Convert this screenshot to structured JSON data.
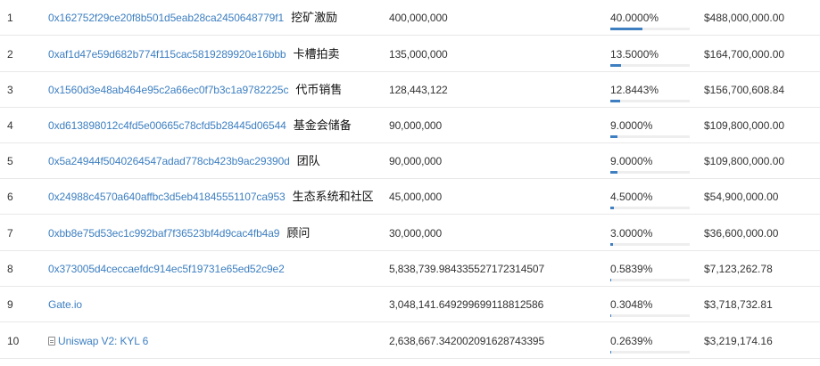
{
  "holders": [
    {
      "rank": "1",
      "address": "0x162752f29ce20f8b501d5eab28ca2450648779f1",
      "tag": "挖矿激励",
      "quantity": "400,000,000",
      "percentage": "40.0000%",
      "fraction": 0.4,
      "value": "$488,000,000.00",
      "icon": ""
    },
    {
      "rank": "2",
      "address": "0xaf1d47e59d682b774f115cac5819289920e16bbb",
      "tag": "卡槽拍卖",
      "quantity": "135,000,000",
      "percentage": "13.5000%",
      "fraction": 0.135,
      "value": "$164,700,000.00",
      "icon": ""
    },
    {
      "rank": "3",
      "address": "0x1560d3e48ab464e95c2a66ec0f7b3c1a9782225c",
      "tag": "代币销售",
      "quantity": "128,443,122",
      "percentage": "12.8443%",
      "fraction": 0.128443,
      "value": "$156,700,608.84",
      "icon": ""
    },
    {
      "rank": "4",
      "address": "0xd613898012c4fd5e00665c78cfd5b28445d06544",
      "tag": "基金会储备",
      "quantity": "90,000,000",
      "percentage": "9.0000%",
      "fraction": 0.09,
      "value": "$109,800,000.00",
      "icon": ""
    },
    {
      "rank": "5",
      "address": "0x5a24944f5040264547adad778cb423b9ac29390d",
      "tag": "团队",
      "quantity": "90,000,000",
      "percentage": "9.0000%",
      "fraction": 0.09,
      "value": "$109,800,000.00",
      "icon": ""
    },
    {
      "rank": "6",
      "address": "0x24988c4570a640affbc3d5eb41845551107ca953",
      "tag": "生态系统和社区",
      "quantity": "45,000,000",
      "percentage": "4.5000%",
      "fraction": 0.045,
      "value": "$54,900,000.00",
      "icon": ""
    },
    {
      "rank": "7",
      "address": "0xbb8e75d53ec1c992baf7f36523bf4d9cac4fb4a9",
      "tag": "顾问",
      "quantity": "30,000,000",
      "percentage": "3.0000%",
      "fraction": 0.03,
      "value": "$36,600,000.00",
      "icon": ""
    },
    {
      "rank": "8",
      "address": "0x373005d4ceccaefdc914ec5f19731e65ed52c9e2",
      "tag": "",
      "quantity": "5,838,739.984335527172314507",
      "percentage": "0.5839%",
      "fraction": 0.005839,
      "value": "$7,123,262.78",
      "icon": ""
    },
    {
      "rank": "9",
      "address": "Gate.io",
      "tag": "",
      "quantity": "3,048,141.649299699118812586",
      "percentage": "0.3048%",
      "fraction": 0.003048,
      "value": "$3,718,732.81",
      "icon": ""
    },
    {
      "rank": "10",
      "address": "Uniswap V2: KYL 6",
      "tag": "",
      "quantity": "2,638,667.342002091628743395",
      "percentage": "0.2639%",
      "fraction": 0.002639,
      "value": "$3,219,174.16",
      "icon": "document-icon"
    }
  ],
  "colors": {
    "link": "#3d7fc1",
    "bar_fill": "#3d7fc1",
    "bar_track": "#eeeeee",
    "row_border": "#e8e8e8"
  }
}
